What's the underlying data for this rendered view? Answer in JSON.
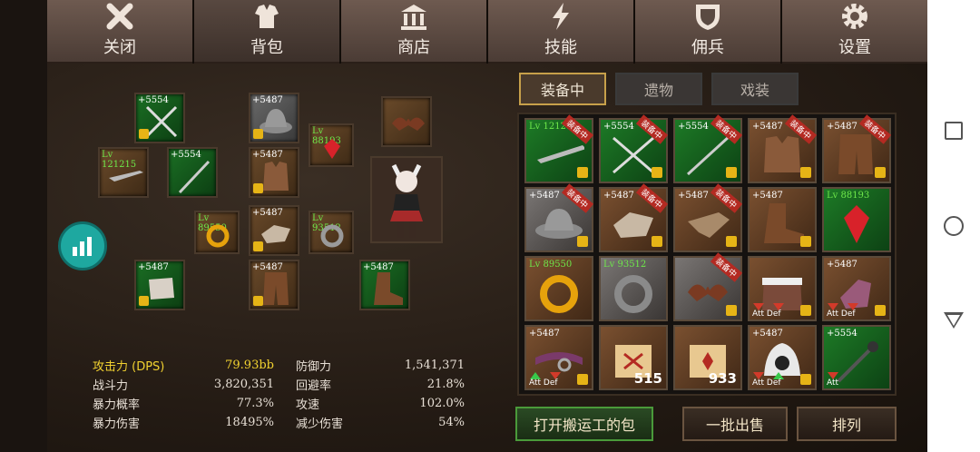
{
  "tabs": [
    {
      "label": "关闭",
      "icon": "close-icon"
    },
    {
      "label": "背包",
      "icon": "armor-icon"
    },
    {
      "label": "商店",
      "icon": "shop-icon"
    },
    {
      "label": "技能",
      "icon": "lightning-icon"
    },
    {
      "label": "佣兵",
      "icon": "shield-icon"
    },
    {
      "label": "设置",
      "icon": "gear-icon"
    }
  ],
  "equipped": {
    "slots": [
      {
        "tag": "+5554",
        "kind": "plus"
      },
      {
        "tag": "+5487",
        "kind": "plus"
      },
      {
        "tag": "Lv 88193",
        "kind": "lv"
      },
      {
        "tag": "",
        "kind": "none"
      },
      {
        "tag": "Lv 121215",
        "kind": "lv"
      },
      {
        "tag": "+5554",
        "kind": "plus"
      },
      {
        "tag": "+5487",
        "kind": "plus"
      },
      {
        "tag": "Lv 89550",
        "kind": "lv"
      },
      {
        "tag": "+5487",
        "kind": "plus"
      },
      {
        "tag": "Lv 93512",
        "kind": "lv"
      },
      {
        "tag": "+5487",
        "kind": "plus"
      },
      {
        "tag": "+5487",
        "kind": "plus"
      },
      {
        "tag": "+5487",
        "kind": "plus"
      }
    ]
  },
  "stats": [
    {
      "k1": "攻击力 (DPS)",
      "v1": "79.93bb",
      "k2": "防御力",
      "v2": "1,541,371"
    },
    {
      "k1": "战斗力",
      "v1": "3,820,351",
      "k2": "回避率",
      "v2": "21.8%"
    },
    {
      "k1": "暴力概率",
      "v1": "77.3%",
      "k2": "攻速",
      "v2": "102.0%"
    },
    {
      "k1": "暴力伤害",
      "v1": "18495%",
      "k2": "减少伤害",
      "v2": "54%"
    }
  ],
  "inventory_tabs": [
    "装备中",
    "遗物",
    "戏装"
  ],
  "equipped_badge": "装备中",
  "inventory": [
    {
      "tag": "Lv 121215",
      "kind": "lv"
    },
    {
      "tag": "+5554",
      "kind": "plus"
    },
    {
      "tag": "+5554",
      "kind": "plus"
    },
    {
      "tag": "+5487",
      "kind": "plus"
    },
    {
      "tag": "+5487",
      "kind": "plus"
    },
    {
      "tag": "+5487",
      "kind": "plus"
    },
    {
      "tag": "+5487",
      "kind": "plus"
    },
    {
      "tag": "+5487",
      "kind": "plus"
    },
    {
      "tag": "+5487",
      "kind": "plus"
    },
    {
      "tag": "Lv 88193",
      "kind": "lv"
    },
    {
      "tag": "Lv 89550",
      "kind": "lv"
    },
    {
      "tag": "Lv 93512",
      "kind": "lv"
    },
    {
      "tag": "",
      "kind": "none"
    },
    {
      "tag": "",
      "kind": "none",
      "att_def": "Att Def"
    },
    {
      "tag": "+5487",
      "kind": "plus",
      "att_def": "Att Def"
    },
    {
      "tag": "+5487",
      "kind": "plus",
      "att_def": "Att Def"
    },
    {
      "tag": "",
      "kind": "none",
      "count": "515"
    },
    {
      "tag": "",
      "kind": "none",
      "count": "933"
    },
    {
      "tag": "+5487",
      "kind": "plus",
      "att_def": "Att Def"
    },
    {
      "tag": "+5554",
      "kind": "plus",
      "att_def": "Att"
    }
  ],
  "buttons": {
    "open_bag": "打开搬运工的包",
    "bulk_sell": "一批出售",
    "sort": "排列"
  },
  "colors": {
    "level_text": "#6ee84a",
    "highlight_stat": "#f2d230",
    "rare_green": "#1d7a26",
    "equipped_badge": "#b42a22"
  }
}
